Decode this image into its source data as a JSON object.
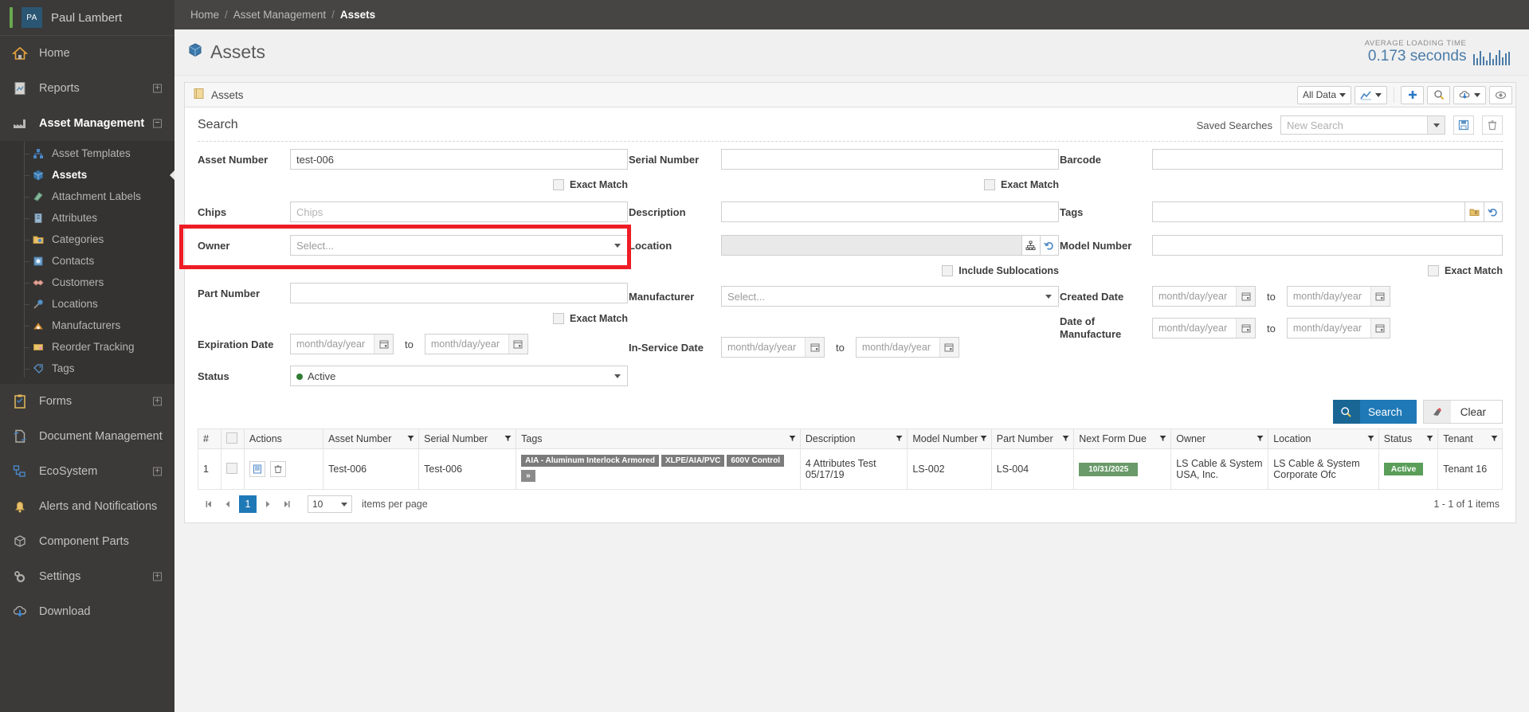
{
  "sidebar": {
    "user": {
      "initials": "PA",
      "name": "Paul Lambert"
    },
    "items": [
      {
        "label": "Home",
        "icon": "home-icon",
        "expander": ""
      },
      {
        "label": "Reports",
        "icon": "reports-icon",
        "expander": "+"
      },
      {
        "label": "Asset Management",
        "icon": "factory-icon",
        "expander": "−"
      }
    ],
    "subitems": [
      {
        "label": "Asset Templates",
        "icon": "template-icon"
      },
      {
        "label": "Assets",
        "icon": "box-icon",
        "selected": true
      },
      {
        "label": "Attachment Labels",
        "icon": "attachment-icon"
      },
      {
        "label": "Attributes",
        "icon": "attributes-icon"
      },
      {
        "label": "Categories",
        "icon": "folder-icon"
      },
      {
        "label": "Contacts",
        "icon": "contacts-icon"
      },
      {
        "label": "Customers",
        "icon": "handshake-icon"
      },
      {
        "label": "Locations",
        "icon": "pin-icon"
      },
      {
        "label": "Manufacturers",
        "icon": "crane-icon"
      },
      {
        "label": "Reorder Tracking",
        "icon": "reorder-icon"
      },
      {
        "label": "Tags",
        "icon": "tag-icon"
      }
    ],
    "items_bottom": [
      {
        "label": "Forms",
        "icon": "clipboard-icon",
        "expander": "+"
      },
      {
        "label": "Document Management",
        "icon": "document-icon",
        "expander": ""
      },
      {
        "label": "EcoSystem",
        "icon": "ecosystem-icon",
        "expander": "+"
      },
      {
        "label": "Alerts and Notifications",
        "icon": "bell-icon",
        "expander": ""
      },
      {
        "label": "Component Parts",
        "icon": "parts-icon",
        "expander": ""
      },
      {
        "label": "Settings",
        "icon": "gear-icon",
        "expander": "+"
      },
      {
        "label": "Download",
        "icon": "download-icon",
        "expander": ""
      }
    ]
  },
  "breadcrumb": {
    "home": "Home",
    "section": "Asset Management",
    "current": "Assets",
    "sep": "/"
  },
  "page": {
    "title": "Assets",
    "loading_label": "AVERAGE LOADING TIME",
    "loading_value": "0.173 seconds"
  },
  "panel": {
    "title": "Assets",
    "toolbar": {
      "all_data": "All Data",
      "chart_btn": "chart-icon",
      "add_btn": "plus-icon",
      "search_btn": "magnifier-icon",
      "export_btn": "cloud-download-icon",
      "view_btn": "eye-icon"
    }
  },
  "search": {
    "title": "Search",
    "saved_searches_label": "Saved Searches",
    "saved_searches_value": "New Search",
    "save_icon": "save-icon",
    "delete_icon": "trash-icon",
    "fields": {
      "asset_number": {
        "label": "Asset Number",
        "value": "test-006",
        "exact_match": "Exact Match"
      },
      "serial_number": {
        "label": "Serial Number",
        "value": "",
        "exact_match": "Exact Match"
      },
      "barcode": {
        "label": "Barcode",
        "value": ""
      },
      "chips": {
        "label": "Chips",
        "placeholder": "Chips",
        "value": ""
      },
      "description": {
        "label": "Description",
        "value": ""
      },
      "tags": {
        "label": "Tags",
        "value": "",
        "picker_icon": "folder-picker-icon",
        "reset_icon": "undo-icon"
      },
      "owner": {
        "label": "Owner",
        "value": "Select..."
      },
      "location": {
        "label": "Location",
        "value": "",
        "tree_icon": "tree-icon",
        "reset_icon": "undo-icon",
        "include_sublocations": "Include Sublocations"
      },
      "model_number": {
        "label": "Model Number",
        "value": "",
        "exact_match": "Exact Match"
      },
      "part_number": {
        "label": "Part Number",
        "value": "",
        "exact_match": "Exact Match"
      },
      "manufacturer": {
        "label": "Manufacturer",
        "value": "Select..."
      },
      "created_date": {
        "label": "Created Date",
        "from": "month/day/year",
        "to_label": "to",
        "to": "month/day/year"
      },
      "expiration_date": {
        "label": "Expiration Date",
        "from": "month/day/year",
        "to_label": "to",
        "to": "month/day/year"
      },
      "in_service_date": {
        "label": "In-Service Date",
        "from": "month/day/year",
        "to_label": "to",
        "to": "month/day/year"
      },
      "date_of_manufacture": {
        "label": "Date of Manufacture",
        "from": "month/day/year",
        "to_label": "to",
        "to": "month/day/year"
      },
      "status": {
        "label": "Status",
        "value": "Active"
      }
    },
    "buttons": {
      "search": "Search",
      "clear": "Clear"
    }
  },
  "table": {
    "columns": [
      "#",
      "",
      "Actions",
      "Asset Number",
      "Serial Number",
      "Tags",
      "Description",
      "Model Number",
      "Part Number",
      "Next Form Due",
      "Owner",
      "Location",
      "Status",
      "Tenant"
    ],
    "rows": [
      {
        "index": "1",
        "asset_number": "Test-006",
        "serial_number": "Test-006",
        "tags": [
          "AIA - Aluminum Interlock Armored",
          "XLPE/AIA/PVC",
          "600V Control"
        ],
        "tags_more": "»",
        "description": "4 Attributes Test 05/17/19",
        "model_number": "LS-002",
        "part_number": "LS-004",
        "next_form_due": "10/31/2025",
        "owner": "LS Cable & System USA, Inc.",
        "location": "LS Cable & System Corporate Ofc",
        "status": "Active",
        "tenant": "Tenant 16"
      }
    ]
  },
  "pager": {
    "first": "⏮",
    "prev": "◀",
    "page": "1",
    "next": "▶",
    "last": "⏭",
    "per_page": "10",
    "per_page_label": "items per page",
    "summary": "1 - 1 of 1 items"
  },
  "colors": {
    "accent": "#1f79b6",
    "highlight": "#ee1c25",
    "sidebar": "#3b3a38",
    "green": "#5a9e5a"
  }
}
